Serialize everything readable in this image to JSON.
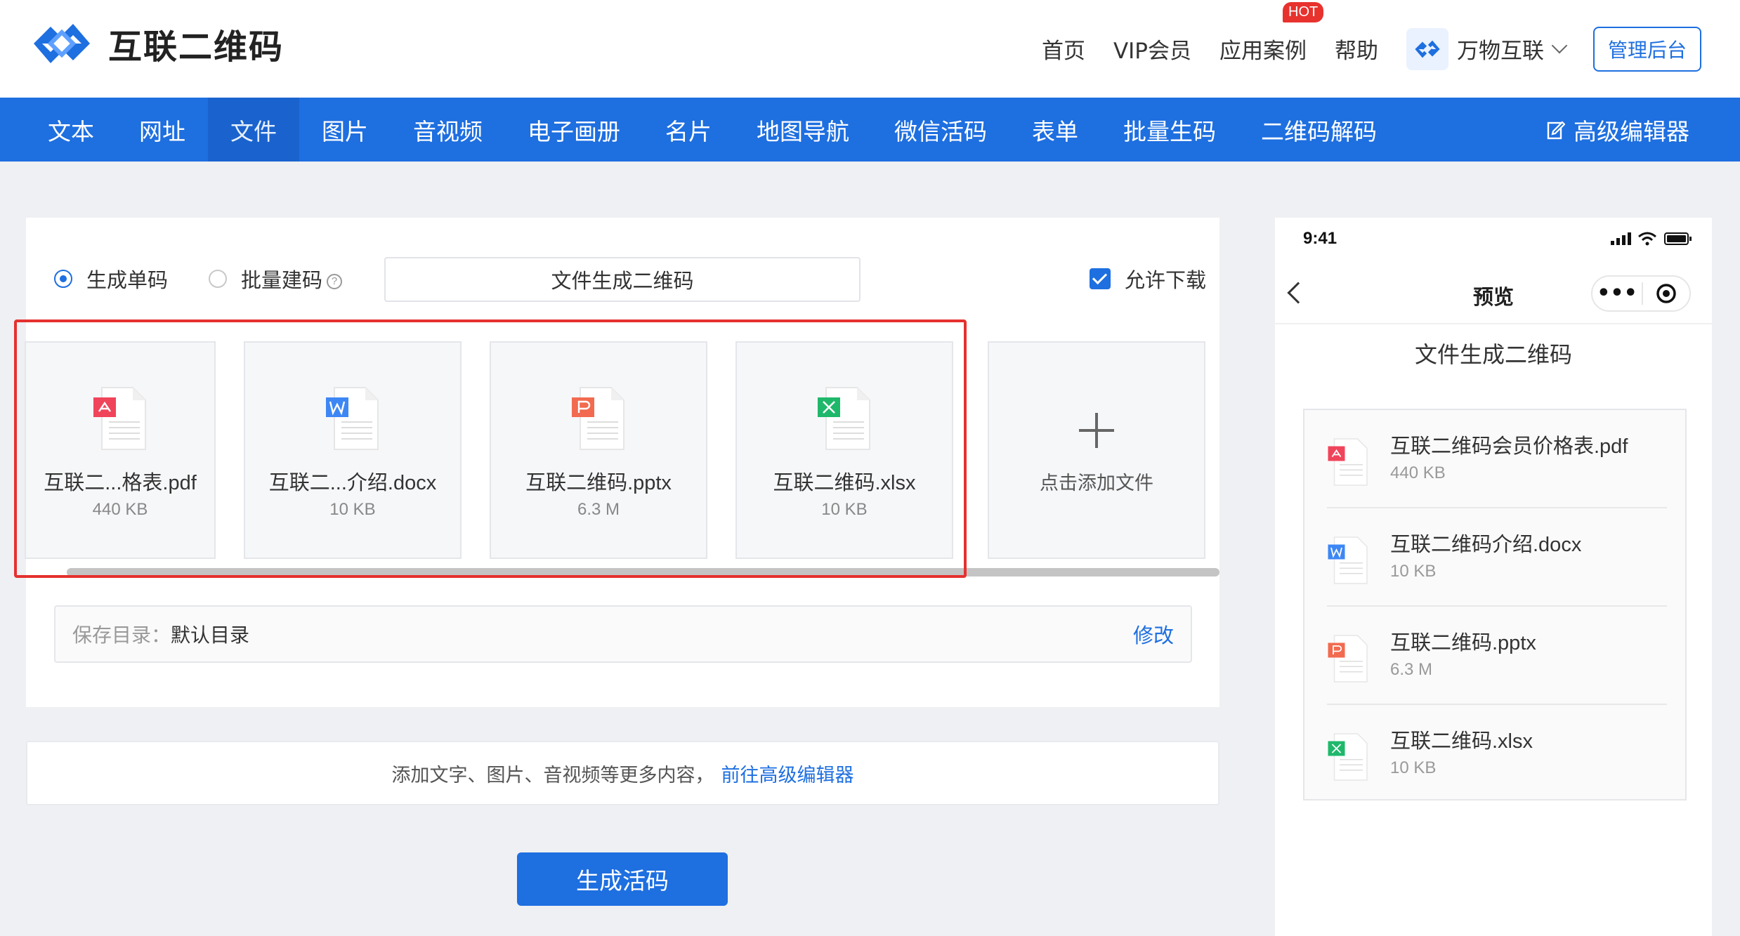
{
  "brand": {
    "name": "互联二维码"
  },
  "topnav": {
    "items": [
      "首页",
      "VIP会员",
      "应用案例",
      "帮助"
    ],
    "hot_badge": "HOT",
    "account": "万物互联",
    "admin_button": "管理后台"
  },
  "bluenav": {
    "items": [
      "文本",
      "网址",
      "文件",
      "图片",
      "音视频",
      "电子画册",
      "名片",
      "地图导航",
      "微信活码",
      "表单",
      "批量生码",
      "二维码解码"
    ],
    "active": "文件",
    "advanced_editor": "高级编辑器"
  },
  "form": {
    "mode_single": "生成单码",
    "mode_batch": "批量建码",
    "help_glyph": "?",
    "title_value": "文件生成二维码",
    "allow_download": "允许下载",
    "add_file": "点击添加文件",
    "save_dir_label": "保存目录：",
    "save_dir_value": "默认目录",
    "save_dir_edit": "修改"
  },
  "files": [
    {
      "display_name": "互联二...格表.pdf",
      "full_name": "互联二维码会员价格表.pdf",
      "size": "440 KB",
      "type": "pdf",
      "color": "#f0445a"
    },
    {
      "display_name": "互联二...介绍.docx",
      "full_name": "互联二维码介绍.docx",
      "size": "10 KB",
      "type": "docx",
      "color": "#3d87f5"
    },
    {
      "display_name": "互联二维码.pptx",
      "full_name": "互联二维码.pptx",
      "size": "6.3 M",
      "type": "pptx",
      "color": "#f26a4f"
    },
    {
      "display_name": "互联二维码.xlsx",
      "full_name": "互联二维码.xlsx",
      "size": "10 KB",
      "type": "xlsx",
      "color": "#1fb86b"
    }
  ],
  "hint": {
    "text": "添加文字、图片、音视频等更多内容，",
    "link": "前往高级编辑器"
  },
  "generate_button": "生成活码",
  "preview": {
    "time": "9:41",
    "title": "预览",
    "capsule_dots": "•••",
    "heading": "文件生成二维码"
  },
  "colors": {
    "primary": "#1e6fe0",
    "highlight": "#e5312f",
    "hot": "#e8322e"
  }
}
